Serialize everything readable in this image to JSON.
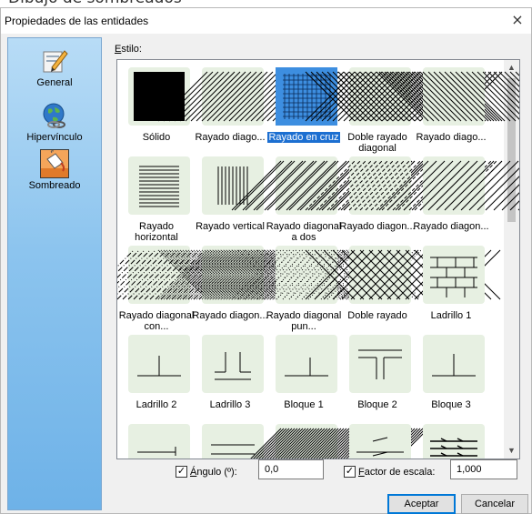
{
  "background_heading": "Dibujo de sombreados",
  "dialog": {
    "title": "Propiedades de las entidades",
    "close_glyph": "×"
  },
  "sidebar": {
    "items": [
      {
        "label": "General",
        "icon": "general-icon"
      },
      {
        "label": "Hipervínculo",
        "icon": "hyperlink-globe-icon"
      },
      {
        "label": "Sombreado",
        "icon": "paint-bucket-icon",
        "active": true
      }
    ]
  },
  "style": {
    "label_prefix": "",
    "label_underlined": "E",
    "label_rest": "stilo:"
  },
  "patterns": [
    {
      "name": "Sólido",
      "pattern": "solid"
    },
    {
      "name": "Rayado diago...",
      "pattern": "diag-fwd"
    },
    {
      "name": "Rayado en cruz",
      "pattern": "grid",
      "selected": true
    },
    {
      "name": "Doble rayado diagonal",
      "pattern": "x-hatch"
    },
    {
      "name": "Rayado diago...",
      "pattern": "diag-back"
    },
    {
      "name": "Rayado horizontal",
      "pattern": "horizontal"
    },
    {
      "name": "Rayado vertical",
      "pattern": "vertical"
    },
    {
      "name": "Rayado diagonal a dos",
      "pattern": "diag-double"
    },
    {
      "name": "Rayado diagon...",
      "pattern": "diag-dash"
    },
    {
      "name": "Rayado diagon...",
      "pattern": "diag-fwd-wide"
    },
    {
      "name": "Rayado diagonal con...",
      "pattern": "diag-dots"
    },
    {
      "name": "Rayado diagon...",
      "pattern": "dense-cross"
    },
    {
      "name": "Rayado diagonal pun...",
      "pattern": "diag-dot-dash"
    },
    {
      "name": "Doble rayado",
      "pattern": "x-hatch-wide"
    },
    {
      "name": "Ladrillo 1",
      "pattern": "brick"
    },
    {
      "name": "Ladrillo 2",
      "pattern": "ladrillo2"
    },
    {
      "name": "Ladrillo 3",
      "pattern": "ladrillo3"
    },
    {
      "name": "Bloque 1",
      "pattern": "bloque1"
    },
    {
      "name": "Bloque 2",
      "pattern": "bloque2"
    },
    {
      "name": "Bloque 3",
      "pattern": "bloque3"
    },
    {
      "name": "",
      "pattern": "row5a"
    },
    {
      "name": "",
      "pattern": "row5b"
    },
    {
      "name": "",
      "pattern": "row5c"
    },
    {
      "name": "",
      "pattern": "row5d"
    },
    {
      "name": "",
      "pattern": "row5e"
    }
  ],
  "angle": {
    "checked": true,
    "label_underlined": "Á",
    "label_rest": "ngulo (º):",
    "value": "0,0"
  },
  "scale": {
    "checked": true,
    "label_underlined": "F",
    "label_rest": "actor de escala:",
    "value": "1,000"
  },
  "buttons": {
    "accept": "Aceptar",
    "cancel": "Cancelar"
  },
  "colors": {
    "sidebar_top": "#b8dcf6",
    "sidebar_bottom": "#6eb2e8",
    "swatch_bg": "#e7f0e2",
    "selection": "#1c6fd1",
    "selected_swatch_bg": "#3d8ee0"
  }
}
